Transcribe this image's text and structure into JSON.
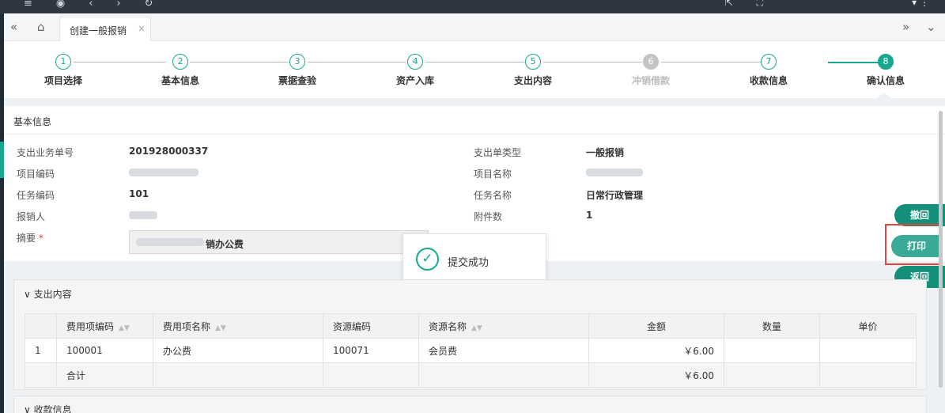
{
  "tab": {
    "label": "创建一般报销"
  },
  "steps": [
    {
      "num": "1",
      "label": "项目选择",
      "state": "done"
    },
    {
      "num": "2",
      "label": "基本信息",
      "state": "done"
    },
    {
      "num": "3",
      "label": "票据查验",
      "state": "done"
    },
    {
      "num": "4",
      "label": "资产入库",
      "state": "done"
    },
    {
      "num": "5",
      "label": "支出内容",
      "state": "done"
    },
    {
      "num": "6",
      "label": "冲销借款",
      "state": "disabled"
    },
    {
      "num": "7",
      "label": "收款信息",
      "state": "done"
    },
    {
      "num": "8",
      "label": "确认信息",
      "state": "active"
    }
  ],
  "basic": {
    "header": "基本信息",
    "left": {
      "doc_no_label": "支出业务单号",
      "doc_no": "201928000337",
      "proj_code_label": "项目编码",
      "task_code_label": "任务编码",
      "task_code": "101",
      "applicant_label": "报销人",
      "memo_label": "摘要",
      "memo_suffix": "销办公费"
    },
    "right": {
      "type_label": "支出单类型",
      "type": "一般报销",
      "proj_name_label": "项目名称",
      "task_name_label": "任务名称",
      "task_name": "日常行政管理",
      "attach_label": "附件数",
      "attach": "1"
    }
  },
  "toast": {
    "text": "提交成功"
  },
  "side_buttons": {
    "revoke": "撤回",
    "print": "打印",
    "back": "返回"
  },
  "expense": {
    "header": "支出内容",
    "columns": [
      "费用项编码",
      "费用项名称",
      "资源编码",
      "资源名称",
      "金额",
      "数量",
      "单价"
    ],
    "rows": [
      {
        "idx": "1",
        "code": "100001",
        "name": "办公费",
        "res_code": "100071",
        "res_name": "会员费",
        "amount": "￥6.00",
        "qty": "",
        "price": ""
      }
    ],
    "total": {
      "label": "合计",
      "amount": "￥6.00"
    }
  },
  "payee": {
    "header": "收款信息"
  }
}
